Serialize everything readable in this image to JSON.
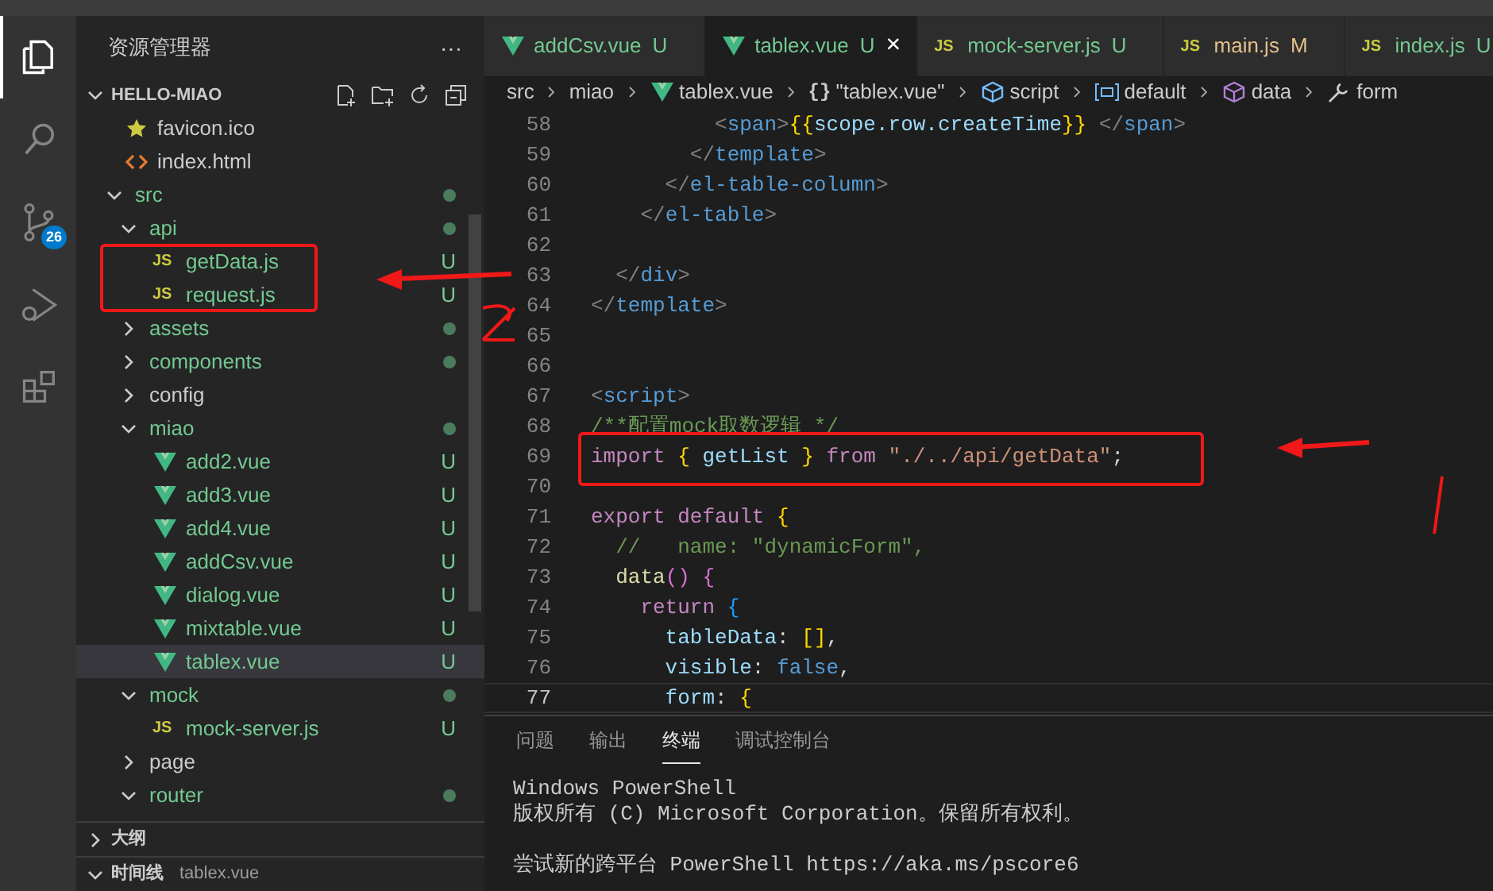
{
  "activity_bar": [
    {
      "kind": "explorer",
      "selected": true
    },
    {
      "kind": "search",
      "selected": false
    },
    {
      "kind": "scm",
      "selected": false,
      "badge": "26"
    },
    {
      "kind": "debug",
      "selected": false
    },
    {
      "kind": "extensions",
      "selected": false
    }
  ],
  "sidebar": {
    "title": "资源管理器",
    "more": "···",
    "root": "HELLO-MIAO",
    "tree": [
      {
        "name": "favicon.ico",
        "kind": "image",
        "untracked": false,
        "dot": false
      },
      {
        "name": "index.html",
        "kind": "html",
        "untracked": false,
        "dot": false
      },
      {
        "name": "src",
        "kind": "folder",
        "expanded": true,
        "untracked": true,
        "dot": true,
        "children": [
          {
            "name": "api",
            "kind": "folder",
            "expanded": true,
            "untracked": true,
            "dot": true,
            "children": [
              {
                "name": "getData.js",
                "kind": "script",
                "icon_text": "JS",
                "untracked": true,
                "git_status": "U"
              },
              {
                "name": "request.js",
                "kind": "script",
                "icon_text": "JS",
                "untracked": true,
                "git_status": "U"
              }
            ]
          },
          {
            "name": "assets",
            "kind": "folder",
            "expanded": false,
            "untracked": true,
            "dot": true
          },
          {
            "name": "components",
            "kind": "folder",
            "expanded": false,
            "untracked": true,
            "dot": true
          },
          {
            "name": "config",
            "kind": "folder",
            "expanded": false,
            "untracked": false,
            "dot": false
          },
          {
            "name": "miao",
            "kind": "folder",
            "expanded": true,
            "untracked": true,
            "dot": true,
            "children": [
              {
                "name": "add2.vue",
                "kind": "vue",
                "untracked": true,
                "git_status": "U",
                "selected": false
              },
              {
                "name": "add3.vue",
                "kind": "vue",
                "untracked": true,
                "git_status": "U",
                "selected": false
              },
              {
                "name": "add4.vue",
                "kind": "vue",
                "untracked": true,
                "git_status": "U",
                "selected": false
              },
              {
                "name": "addCsv.vue",
                "kind": "vue",
                "untracked": true,
                "git_status": "U",
                "selected": false
              },
              {
                "name": "dialog.vue",
                "kind": "vue",
                "untracked": true,
                "git_status": "U",
                "selected": false
              },
              {
                "name": "mixtable.vue",
                "kind": "vue",
                "untracked": true,
                "git_status": "U",
                "selected": false
              },
              {
                "name": "tablex.vue",
                "kind": "vue",
                "untracked": true,
                "git_status": "U",
                "selected": true
              }
            ]
          },
          {
            "name": "mock",
            "kind": "folder",
            "expanded": true,
            "untracked": true,
            "dot": true,
            "children": [
              {
                "name": "mock-server.js",
                "kind": "script",
                "icon_text": "JS",
                "untracked": true,
                "git_status": "U"
              }
            ]
          },
          {
            "name": "page",
            "kind": "folder",
            "expanded": false,
            "untracked": false,
            "dot": false
          },
          {
            "name": "router",
            "kind": "folder",
            "expanded": true,
            "untracked": true,
            "dot": true
          }
        ]
      }
    ],
    "sections": [
      {
        "title": "大纲",
        "expanded": false
      },
      {
        "title": "时间线",
        "expanded": true,
        "detail": "tablex.vue"
      }
    ]
  },
  "tabs": [
    {
      "name": "addCsv.vue",
      "kind": "vue",
      "status": "U",
      "selected": false
    },
    {
      "name": "tablex.vue",
      "kind": "vue",
      "status": "U",
      "selected": true,
      "close": "×"
    },
    {
      "name": "mock-server.js",
      "kind": "script",
      "icon_text": "JS",
      "status": "U",
      "selected": false
    },
    {
      "name": "main.js",
      "kind": "script",
      "icon_text": "JS",
      "status": "M",
      "selected": false
    },
    {
      "name": "index.js",
      "kind": "script",
      "icon_text": "JS",
      "status": "U",
      "selected": false
    }
  ],
  "breadcrumb": [
    {
      "text": "src",
      "kind": "folder"
    },
    {
      "text": "miao",
      "kind": "folder"
    },
    {
      "text": "tablex.vue",
      "kind": "vue"
    },
    {
      "text": "\"tablex.vue\"",
      "kind": "object",
      "icon_text": "{}"
    },
    {
      "text": "script",
      "kind": "module"
    },
    {
      "text": "default",
      "kind": "variable"
    },
    {
      "text": "data",
      "kind": "method"
    },
    {
      "text": "form",
      "kind": "property"
    }
  ],
  "code": [
    {
      "number": "58",
      "current": false,
      "tokens": [
        {
          "text": "          <",
          "kind": "punct"
        },
        {
          "text": "span",
          "kind": "tag"
        },
        {
          "text": ">",
          "kind": "punct"
        },
        {
          "text": "{{",
          "kind": "bracket"
        },
        {
          "text": "scope.row.createTime",
          "kind": "var"
        },
        {
          "text": "}}",
          "kind": "bracket"
        },
        {
          "text": " </",
          "kind": "punct"
        },
        {
          "text": "span",
          "kind": "tag"
        },
        {
          "text": ">",
          "kind": "punct"
        }
      ]
    },
    {
      "number": "59",
      "current": false,
      "tokens": [
        {
          "text": "        </",
          "kind": "punct"
        },
        {
          "text": "template",
          "kind": "tag"
        },
        {
          "text": ">",
          "kind": "punct"
        }
      ]
    },
    {
      "number": "60",
      "current": false,
      "tokens": [
        {
          "text": "      </",
          "kind": "punct"
        },
        {
          "text": "el-table-column",
          "kind": "tag"
        },
        {
          "text": ">",
          "kind": "punct"
        }
      ]
    },
    {
      "number": "61",
      "current": false,
      "tokens": [
        {
          "text": "    </",
          "kind": "punct"
        },
        {
          "text": "el-table",
          "kind": "tag"
        },
        {
          "text": ">",
          "kind": "punct"
        }
      ]
    },
    {
      "number": "62",
      "current": false
    },
    {
      "number": "63",
      "current": false,
      "tokens": [
        {
          "text": "  </",
          "kind": "punct"
        },
        {
          "text": "div",
          "kind": "tag"
        },
        {
          "text": ">",
          "kind": "punct"
        }
      ]
    },
    {
      "number": "64",
      "current": false,
      "tokens": [
        {
          "text": "</",
          "kind": "punct"
        },
        {
          "text": "template",
          "kind": "tag"
        },
        {
          "text": ">",
          "kind": "punct"
        }
      ]
    },
    {
      "number": "65",
      "current": false
    },
    {
      "number": "66",
      "current": false
    },
    {
      "number": "67",
      "current": false,
      "tokens": [
        {
          "text": "<",
          "kind": "punct"
        },
        {
          "text": "script",
          "kind": "tag"
        },
        {
          "text": ">",
          "kind": "punct"
        }
      ]
    },
    {
      "number": "68",
      "current": false,
      "tokens": [
        {
          "text": "/**配置mock取数逻辑 */",
          "kind": "comment"
        }
      ]
    },
    {
      "number": "69",
      "current": false,
      "tokens": [
        {
          "text": "import ",
          "kind": "keyword"
        },
        {
          "text": "{",
          "kind": "bracket"
        },
        {
          "text": " getList ",
          "kind": "var"
        },
        {
          "text": "}",
          "kind": "bracket"
        },
        {
          "text": " from ",
          "kind": "keyword"
        },
        {
          "text": "\"./../api/getData\"",
          "kind": "string"
        },
        {
          "text": ";",
          "kind": "plain"
        }
      ]
    },
    {
      "number": "70",
      "current": false
    },
    {
      "number": "71",
      "current": false,
      "tokens": [
        {
          "text": "export default ",
          "kind": "keyword"
        },
        {
          "text": "{",
          "kind": "bracket"
        }
      ]
    },
    {
      "number": "72",
      "current": false,
      "tokens": [
        {
          "text": "  //   name: \"dynamicForm\",",
          "kind": "comment"
        }
      ]
    },
    {
      "number": "73",
      "current": false,
      "tokens": [
        {
          "text": "  data",
          "kind": "function"
        },
        {
          "text": "() {",
          "kind": "bracket2"
        }
      ]
    },
    {
      "number": "74",
      "current": false,
      "tokens": [
        {
          "text": "    return ",
          "kind": "keyword"
        },
        {
          "text": "{",
          "kind": "bracket3"
        }
      ]
    },
    {
      "number": "75",
      "current": false,
      "tokens": [
        {
          "text": "      tableData",
          "kind": "var"
        },
        {
          "text": ": ",
          "kind": "plain"
        },
        {
          "text": "[]",
          "kind": "bracket"
        },
        {
          "text": ",",
          "kind": "plain"
        }
      ]
    },
    {
      "number": "76",
      "current": false,
      "tokens": [
        {
          "text": "      visible",
          "kind": "var"
        },
        {
          "text": ": ",
          "kind": "plain"
        },
        {
          "text": "false",
          "kind": "constant"
        },
        {
          "text": ",",
          "kind": "plain"
        }
      ]
    },
    {
      "number": "77",
      "current": true,
      "tokens": [
        {
          "text": "      form",
          "kind": "var"
        },
        {
          "text": ": ",
          "kind": "plain"
        },
        {
          "text": "{",
          "kind": "bracket"
        }
      ]
    }
  ],
  "panel": {
    "tabs": [
      {
        "label": "问题",
        "selected": false
      },
      {
        "label": "输出",
        "selected": false
      },
      {
        "label": "终端",
        "selected": true
      },
      {
        "label": "调试控制台",
        "selected": false
      }
    ],
    "terminal": [
      [
        "Windows PowerShell",
        "版权所有 (C) Microsoft Corporation。保留所有权利。"
      ],
      [
        "尝试新的跨平台 PowerShell https://aka.ms/pscore6"
      ]
    ]
  },
  "annotations": [
    {
      "kind": "box"
    },
    {
      "kind": "arrow"
    },
    {
      "kind": "scribble"
    },
    {
      "kind": "box"
    },
    {
      "kind": "arrow"
    },
    {
      "kind": "scribble"
    }
  ]
}
